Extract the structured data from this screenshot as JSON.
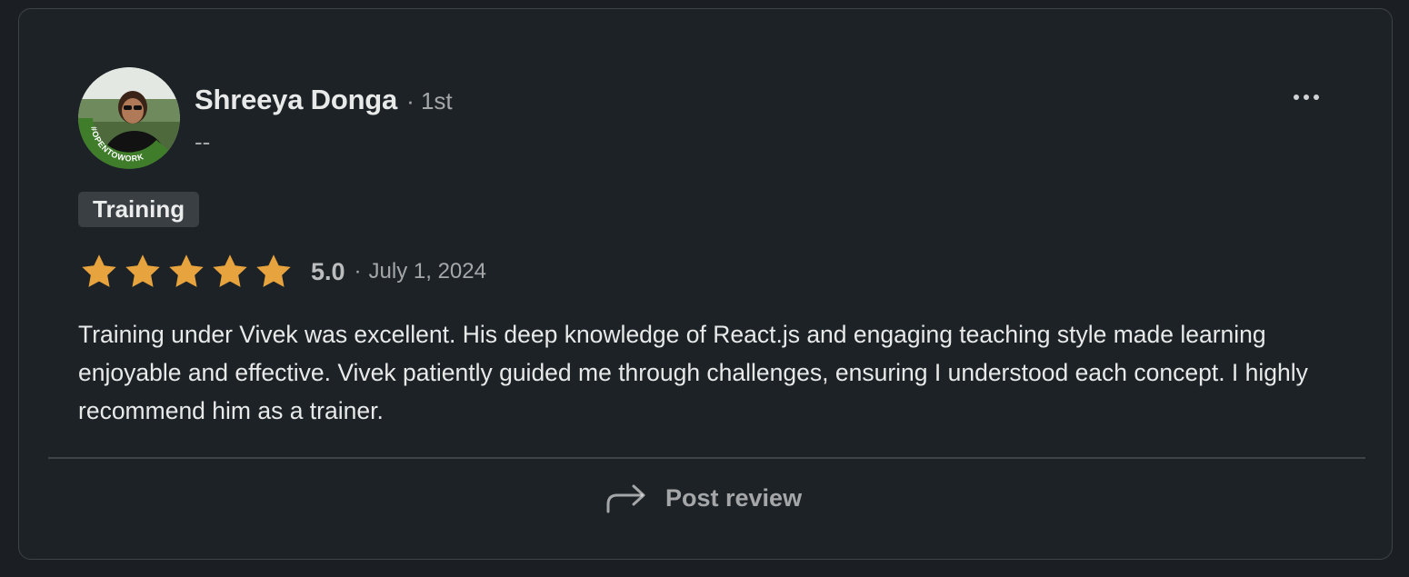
{
  "review": {
    "author_name": "Shreeya Donga",
    "connection_degree": "· 1st",
    "headline": "--",
    "avatar_badge_text": "#OPENTOWORK",
    "service_tag": "Training",
    "rating": 5.0,
    "rating_label": "5.0",
    "rating_separator": "·",
    "date": "July 1, 2024",
    "text": "Training under Vivek was excellent. His deep knowledge of React.js and engaging teaching style made learning enjoyable and effective. Vivek patiently guided me through challenges, ensuring I understood each concept. I highly recommend him as a trainer."
  },
  "actions": {
    "more_icon": "ellipsis-icon",
    "post_icon": "share-arrow-icon",
    "post_label": "Post review"
  },
  "colors": {
    "background": "#1b1f23",
    "card": "#1d2226",
    "star": "#e7a33e",
    "tag_background": "#3a3f44",
    "opentowork_ring": "#3f7d2b"
  }
}
